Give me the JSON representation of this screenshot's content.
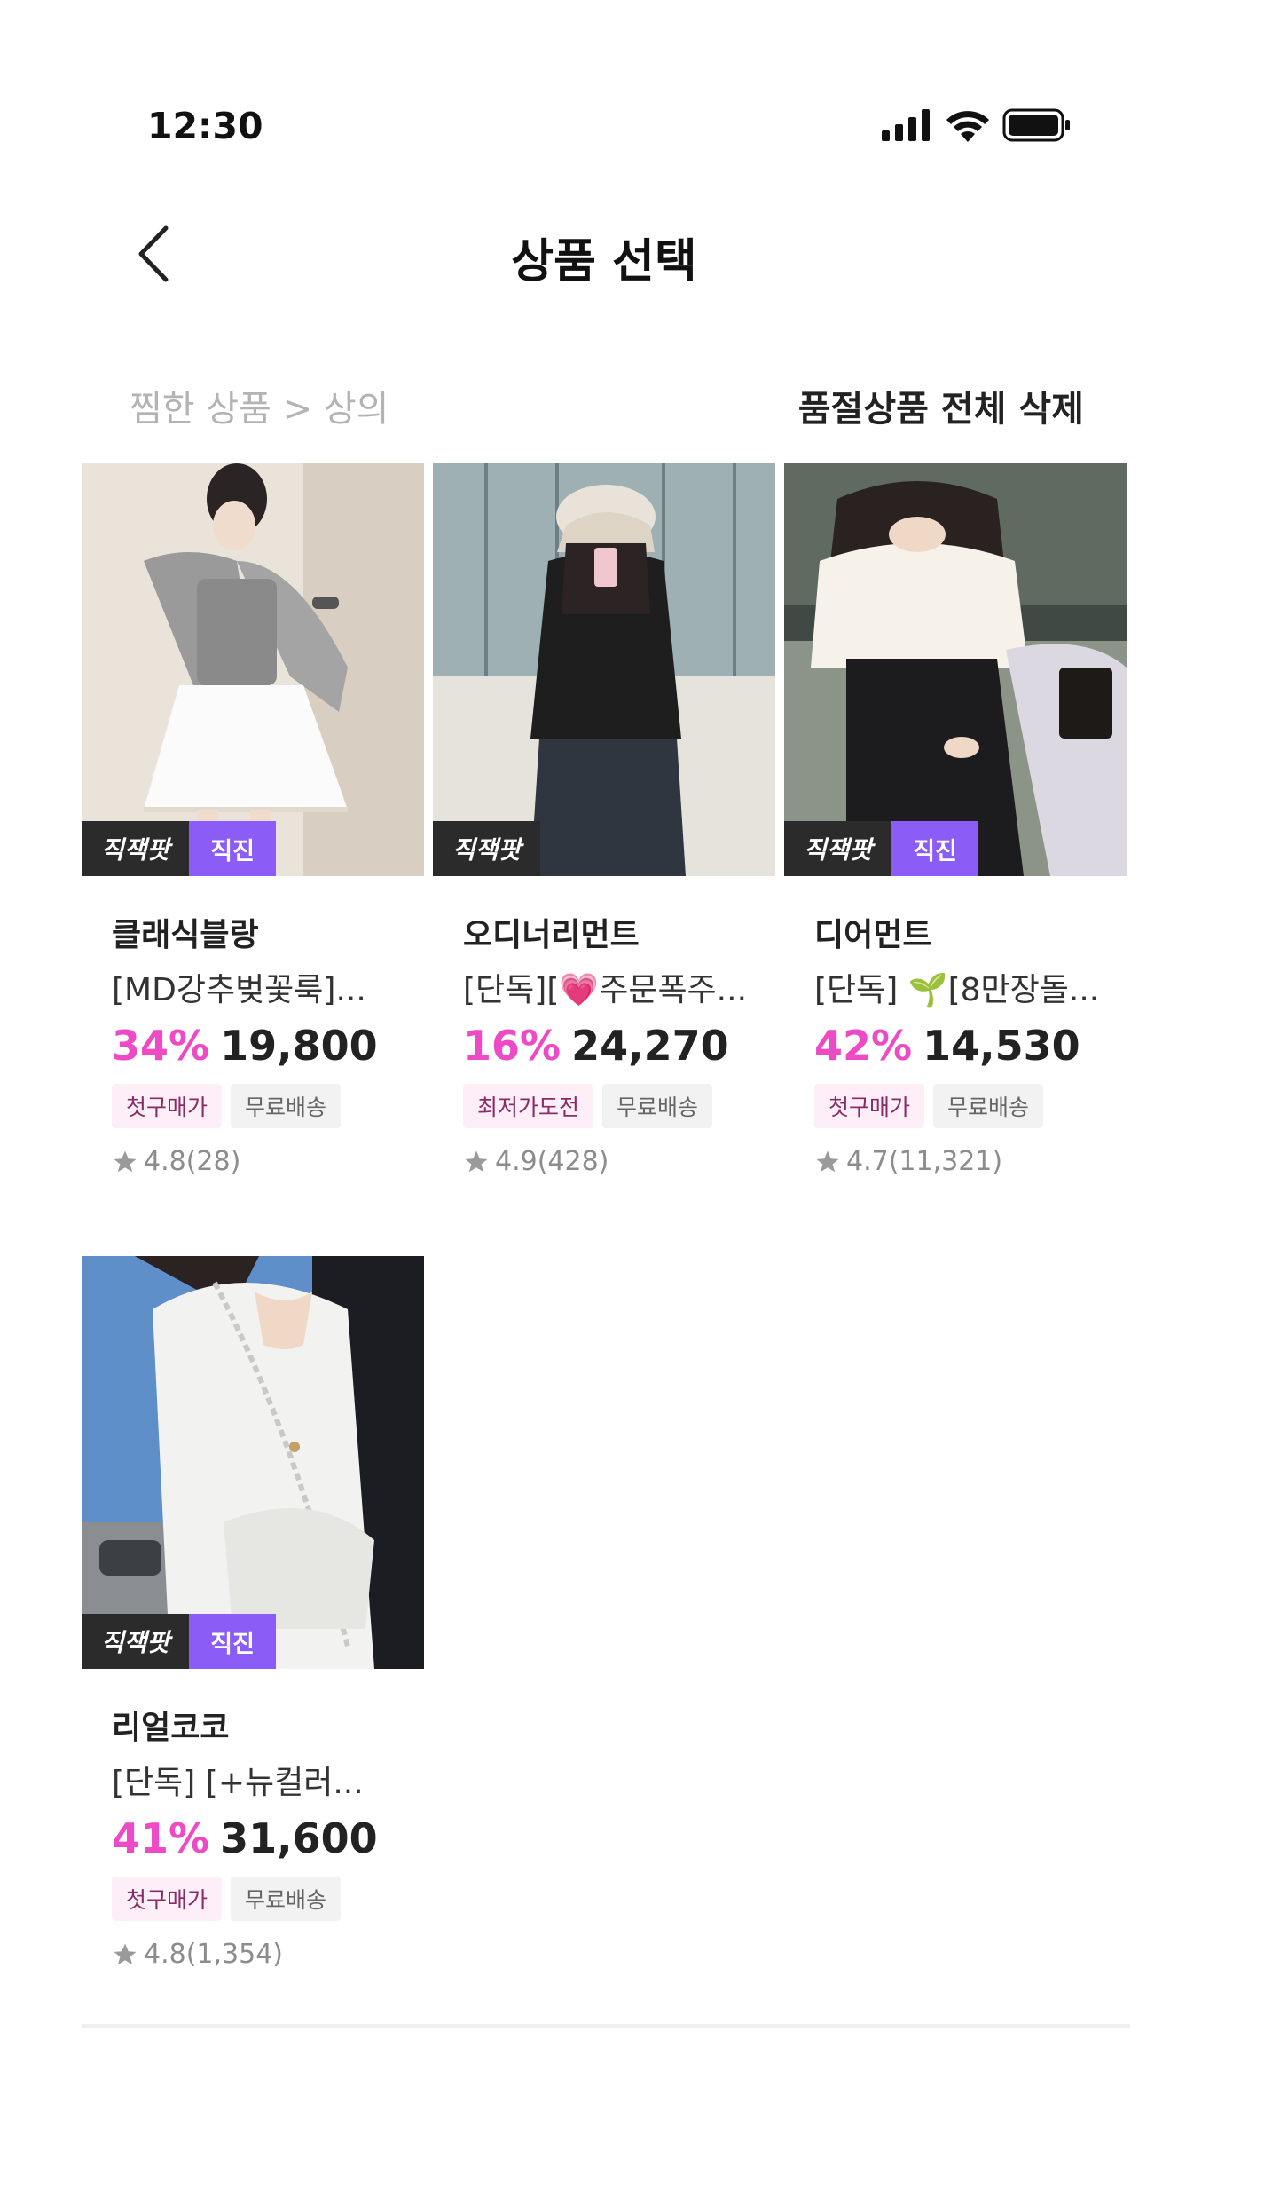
{
  "status": {
    "time": "12:30"
  },
  "header": {
    "title": "상품 선택"
  },
  "subbar": {
    "breadcrumb": "찜한 상품 > 상의",
    "delete_all": "품절상품 전체 삭제"
  },
  "colors": {
    "discount": "#ee4ac6",
    "direct_badge": "#8b5cf6",
    "brand_badge": "#2b2b2b"
  },
  "products": [
    {
      "brand": "클래식블랑",
      "name": "[MD강추벚꽃룩]...",
      "discount": "34%",
      "price": "19,800",
      "badge_brand": "직잭팟",
      "badge_direct": "직진",
      "tags": [
        "첫구매가",
        "무료배송"
      ],
      "rating": "4.8(28)"
    },
    {
      "brand": "오디너리먼트",
      "name": "[단독][💗주문폭주...",
      "discount": "16%",
      "price": "24,270",
      "badge_brand": "직잭팟",
      "badge_direct": "",
      "tags": [
        "최저가도전",
        "무료배송"
      ],
      "rating": "4.9(428)"
    },
    {
      "brand": "디어먼트",
      "name": "[단독] 🌱[8만장돌...",
      "discount": "42%",
      "price": "14,530",
      "badge_brand": "직잭팟",
      "badge_direct": "직진",
      "tags": [
        "첫구매가",
        "무료배송"
      ],
      "rating": "4.7(11,321)"
    },
    {
      "brand": "리얼코코",
      "name": "[단독] [+뉴컬러...",
      "discount": "41%",
      "price": "31,600",
      "badge_brand": "직잭팟",
      "badge_direct": "직진",
      "tags": [
        "첫구매가",
        "무료배송"
      ],
      "rating": "4.8(1,354)"
    }
  ]
}
